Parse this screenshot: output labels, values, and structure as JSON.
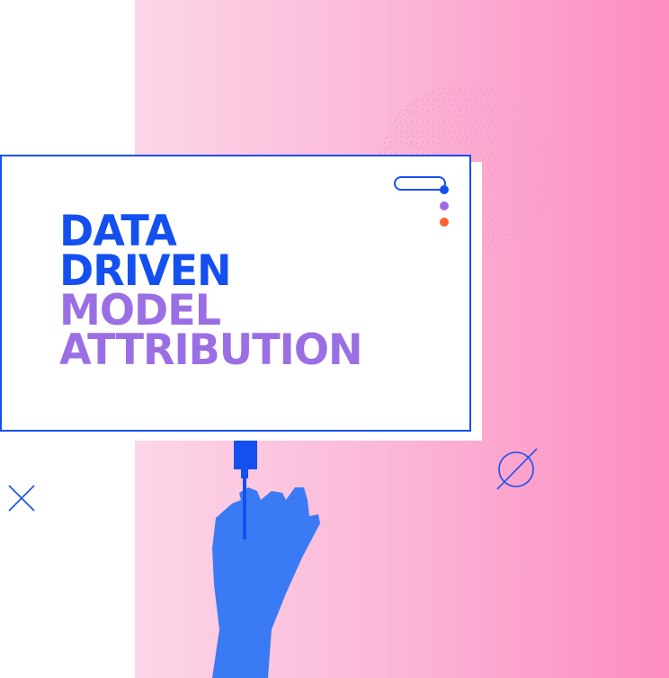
{
  "title": {
    "line1": "DATA",
    "line2": "DRIVEN",
    "line3": "MODEL",
    "line4": "ATTRIBUTION"
  },
  "colors": {
    "blue": "#1450f0",
    "purple": "#9b6fe4",
    "orange": "#ff6230",
    "pink_light": "#fcd6e8",
    "pink_dark": "#fd8dc2",
    "hand": "#3a7af5"
  },
  "icons": [
    "x-mark-icon",
    "empty-set-icon",
    "dotted-circle-icon",
    "hand-icon",
    "usb-plug-icon"
  ]
}
